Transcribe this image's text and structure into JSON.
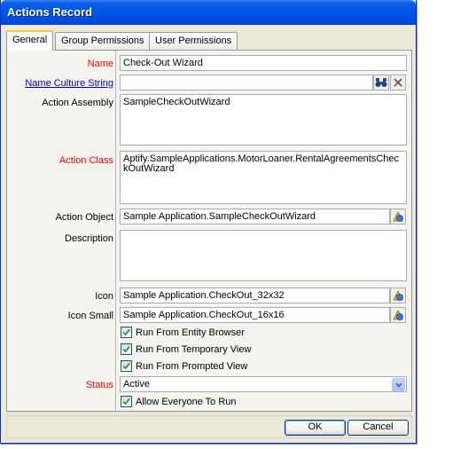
{
  "window": {
    "title": "Actions Record"
  },
  "tabs": [
    {
      "label": "General",
      "active": true
    },
    {
      "label": "Group Permissions",
      "active": false
    },
    {
      "label": "User Permissions",
      "active": false
    }
  ],
  "fields": {
    "name": {
      "label": "Name",
      "value": "Check-Out Wizard"
    },
    "name_culture": {
      "label": "Name Culture String",
      "value": ""
    },
    "action_assembly": {
      "label": "Action Assembly",
      "value": "SampleCheckOutWizard"
    },
    "action_class": {
      "label": "Action Class",
      "value": "Aptify.SampleApplications.MotorLoaner.RentalAgreementsCheckOutWizard"
    },
    "action_object": {
      "label": "Action Object",
      "value": "Sample Application.SampleCheckOutWizard"
    },
    "description": {
      "label": "Description",
      "value": ""
    },
    "icon": {
      "label": "Icon",
      "value": "Sample Application.CheckOut_32x32"
    },
    "icon_small": {
      "label": "Icon Small",
      "value": "Sample Application.CheckOut_16x16"
    },
    "status": {
      "label": "Status",
      "value": "Active"
    }
  },
  "checkboxes": {
    "entity_browser": {
      "label": "Run From Entity Browser",
      "checked": true
    },
    "temporary_view": {
      "label": "Run From Temporary View",
      "checked": true
    },
    "prompted_view": {
      "label": "Run From Prompted View",
      "checked": true
    },
    "allow_everyone": {
      "label": "Allow Everyone To Run",
      "checked": true
    }
  },
  "buttons": {
    "ok": "OK",
    "cancel": "Cancel"
  },
  "colors": {
    "required_label": "#ff0000",
    "link_label": "#0000cc",
    "titlebar": "#0055e5"
  }
}
